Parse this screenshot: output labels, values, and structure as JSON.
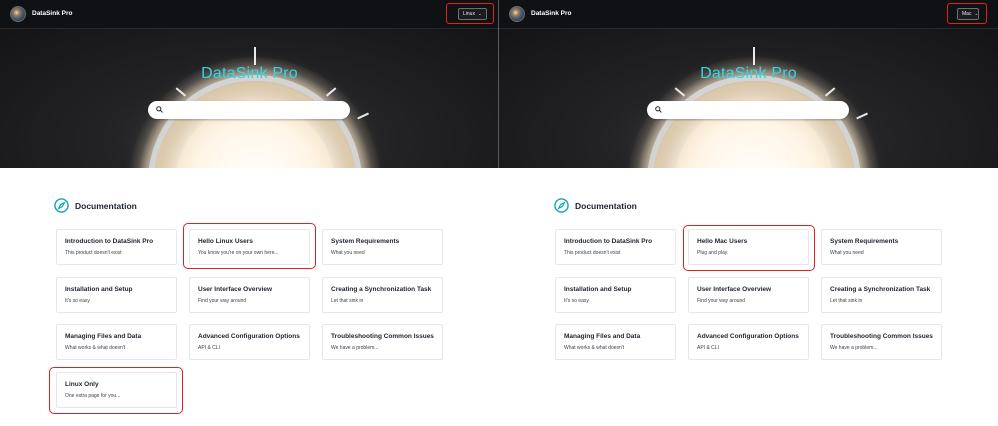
{
  "panes": [
    {
      "brand": "DataSink Pro",
      "platform": "Linux",
      "hero_title": "DataSink Pro",
      "docs_title": "Documentation",
      "cards": [
        {
          "title": "Introduction to DataSink Pro",
          "desc": "This product doesn't exist"
        },
        {
          "title": "Hello Linux Users",
          "desc": "You know you're on your own here..."
        },
        {
          "title": "System Requirements",
          "desc": "What you need"
        },
        {
          "title": "Installation and Setup",
          "desc": "It's so easy"
        },
        {
          "title": "User Interface Overview",
          "desc": "Find your way around"
        },
        {
          "title": "Creating a Synchronization Task",
          "desc": "Let that sink in"
        },
        {
          "title": "Managing Files and Data",
          "desc": "What works & what doesn't"
        },
        {
          "title": "Advanced Configuration Options",
          "desc": "API & CLI"
        },
        {
          "title": "Troubleshooting Common Issues",
          "desc": "We have a problem..."
        },
        {
          "title": "Linux Only",
          "desc": "One extra page for you..."
        }
      ]
    },
    {
      "brand": "DataSink Pro",
      "platform": "Mac",
      "hero_title": "DataSink Pro",
      "docs_title": "Documentation",
      "cards": [
        {
          "title": "Introduction to DataSink Pro",
          "desc": "This product doesn't exist"
        },
        {
          "title": "Hello Mac Users",
          "desc": "Plug and play."
        },
        {
          "title": "System Requirements",
          "desc": "What you need"
        },
        {
          "title": "Installation and Setup",
          "desc": "It's so easy"
        },
        {
          "title": "User Interface Overview",
          "desc": "Find your way around"
        },
        {
          "title": "Creating a Synchronization Task",
          "desc": "Let that sink in"
        },
        {
          "title": "Managing Files and Data",
          "desc": "What works & what doesn't"
        },
        {
          "title": "Advanced Configuration Options",
          "desc": "API & CLI"
        },
        {
          "title": "Troubleshooting Common Issues",
          "desc": "We have a problem..."
        }
      ]
    }
  ],
  "colors": {
    "highlight": "#e32020",
    "hero_title": "#33d6e6",
    "icon_teal": "#15a3b8",
    "navbar_bg": "#101114"
  },
  "icons": [
    "search-icon",
    "compass-icon",
    "chevron-down-icon"
  ]
}
